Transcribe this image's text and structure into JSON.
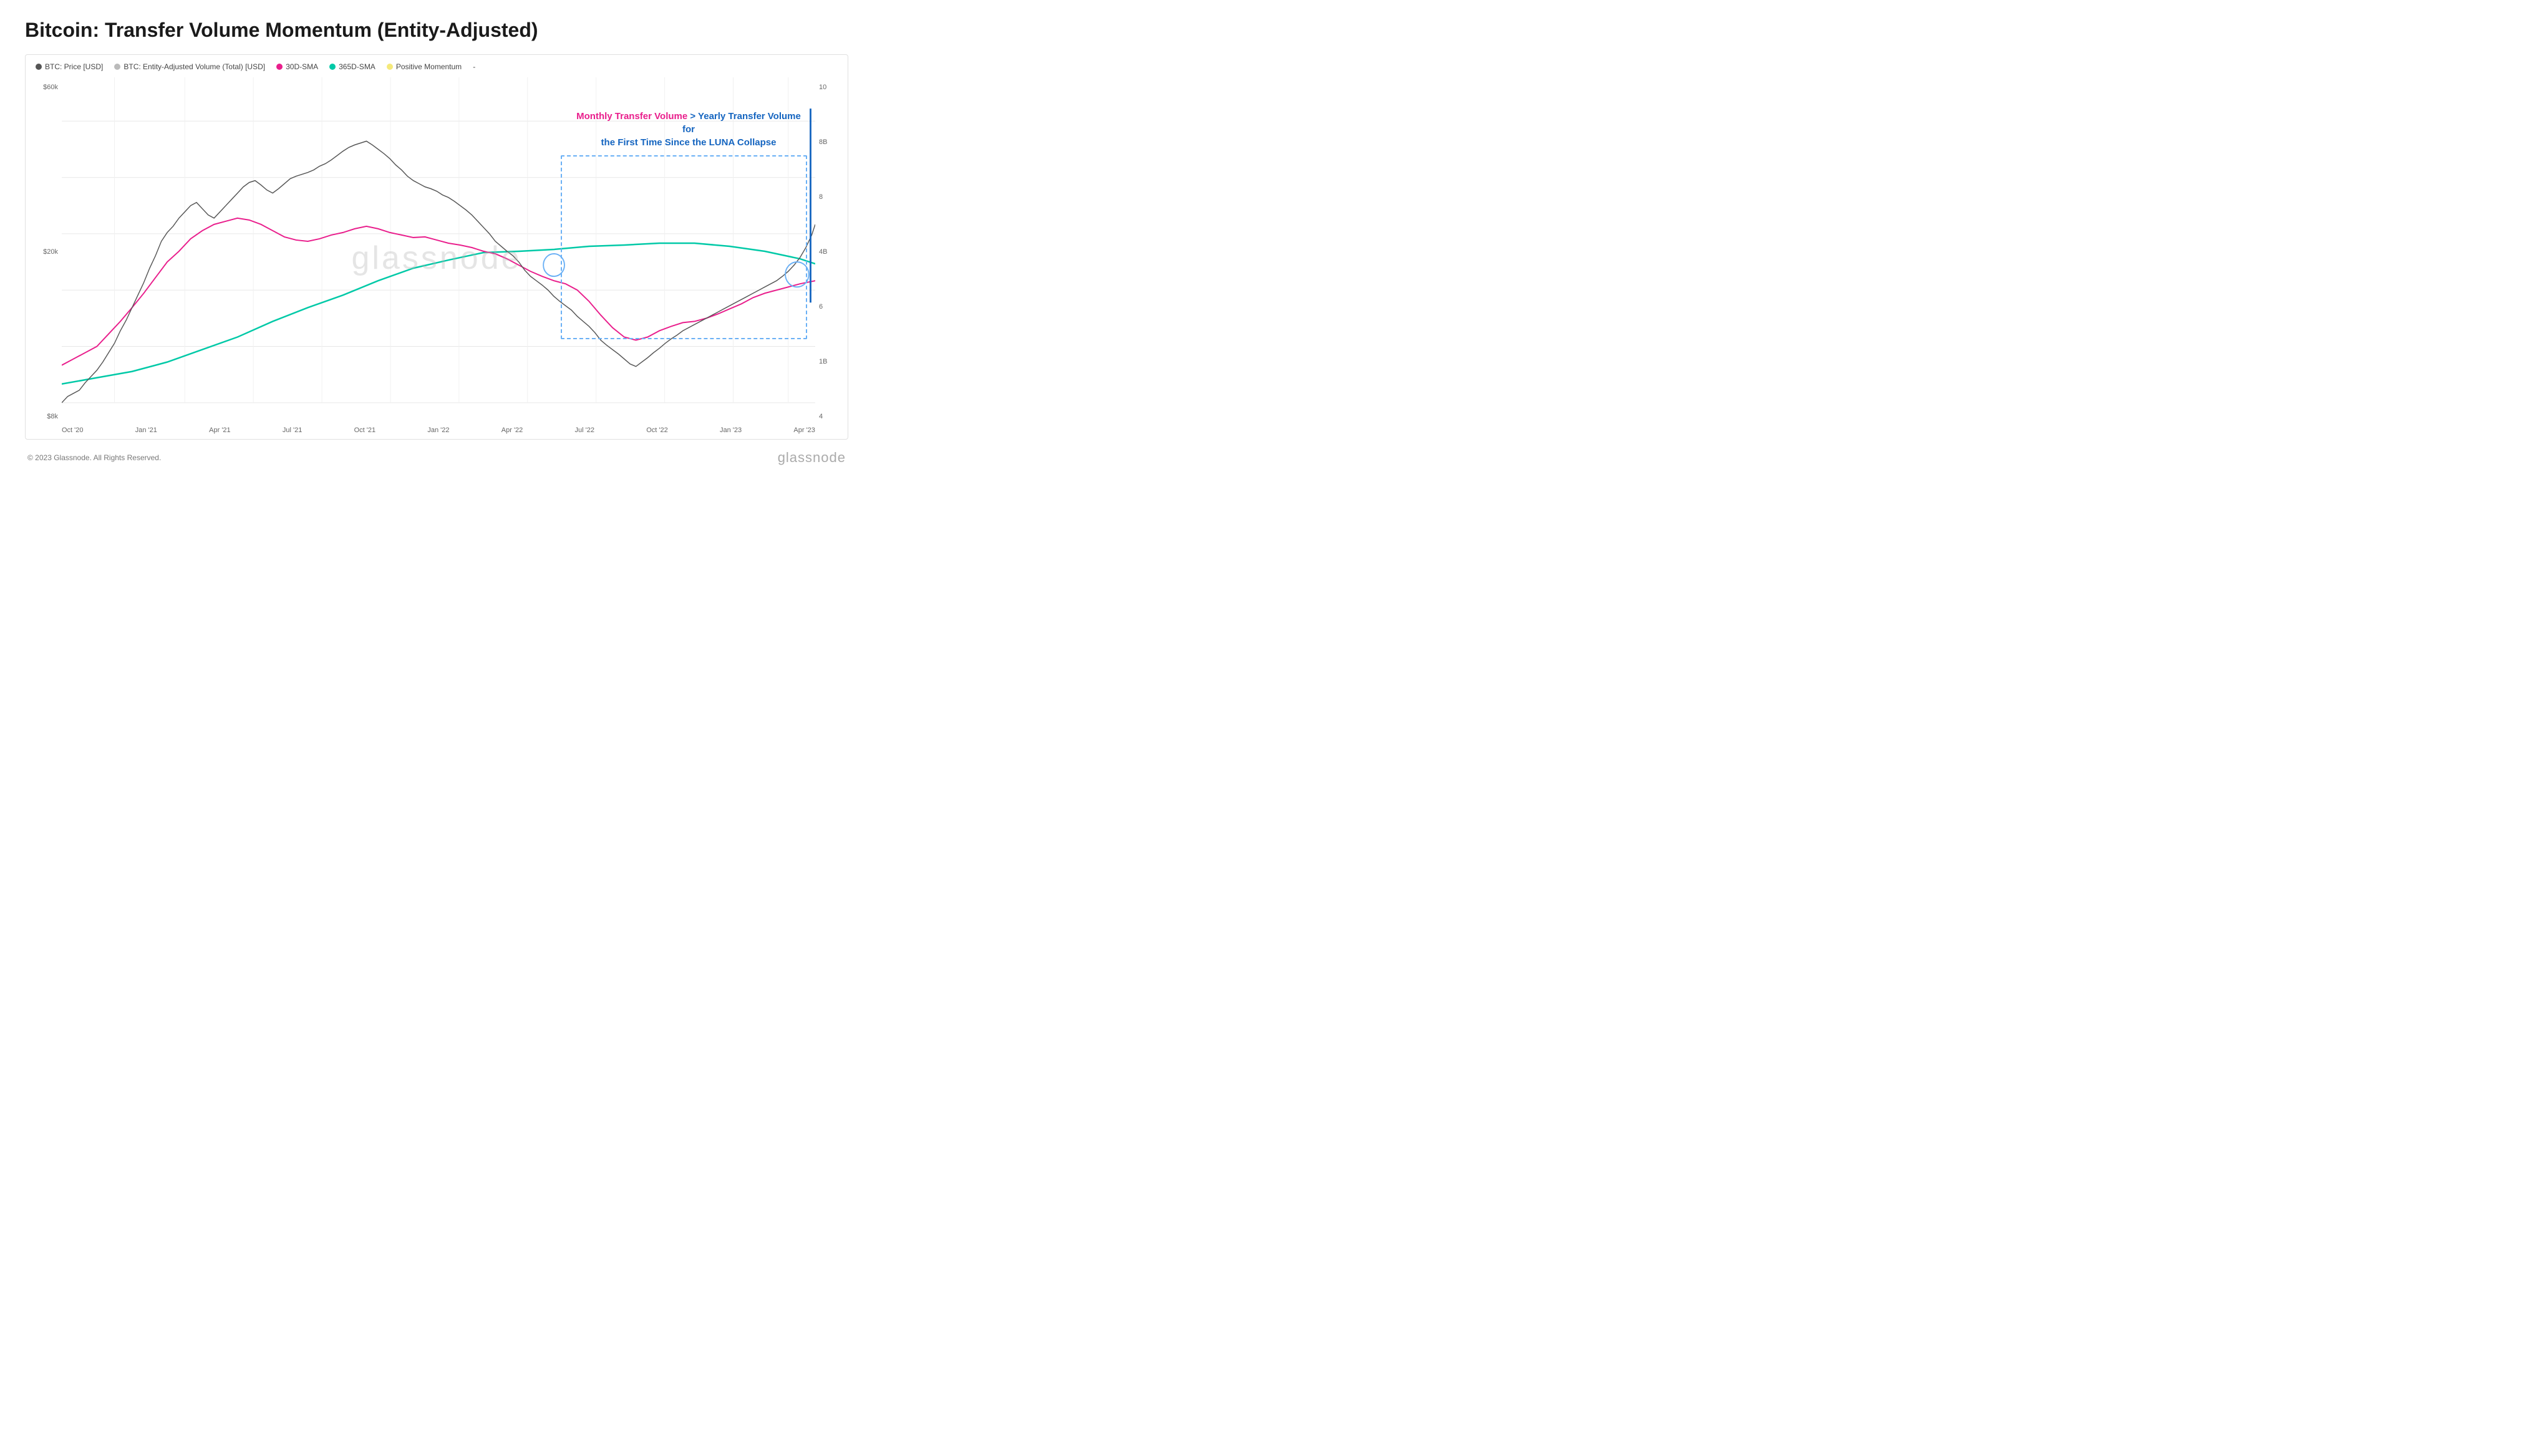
{
  "title": "Bitcoin: Transfer Volume Momentum (Entity-Adjusted)",
  "legend": [
    {
      "id": "btc-price",
      "label": "BTC: Price [USD]",
      "color": "#555555",
      "type": "line"
    },
    {
      "id": "btc-volume",
      "label": "BTC: Entity-Adjusted Volume (Total) [USD]",
      "color": "#cccccc",
      "type": "line"
    },
    {
      "id": "sma30",
      "label": "30D-SMA",
      "color": "#e91e8c",
      "type": "line"
    },
    {
      "id": "sma365",
      "label": "365D-SMA",
      "color": "#00c9a7",
      "type": "line"
    },
    {
      "id": "positive-momentum",
      "label": "Positive Momentum",
      "color": "#f5e97a",
      "type": "fill"
    },
    {
      "id": "dash",
      "label": "-",
      "color": "#999",
      "type": "text"
    }
  ],
  "annotation": {
    "pink_text": "Monthly Transfer Volume",
    "connector": " > ",
    "blue_text": "Yearly Transfer Volume for",
    "line2": "the First Time Since the LUNA Collapse"
  },
  "y_axis_left": [
    "$60k",
    "$20k",
    "$8k"
  ],
  "y_axis_right": [
    "10",
    "8B",
    "8",
    "4B",
    "6",
    "1B",
    "4"
  ],
  "x_axis_labels": [
    "Oct '20",
    "Jan '21",
    "Apr '21",
    "Jul '21",
    "Oct '21",
    "Jan '22",
    "Apr '22",
    "Jul '22",
    "Oct '22",
    "Jan '23",
    "Apr '23"
  ],
  "footer": {
    "copyright": "© 2023 Glassnode. All Rights Reserved.",
    "logo": "glassnode"
  }
}
